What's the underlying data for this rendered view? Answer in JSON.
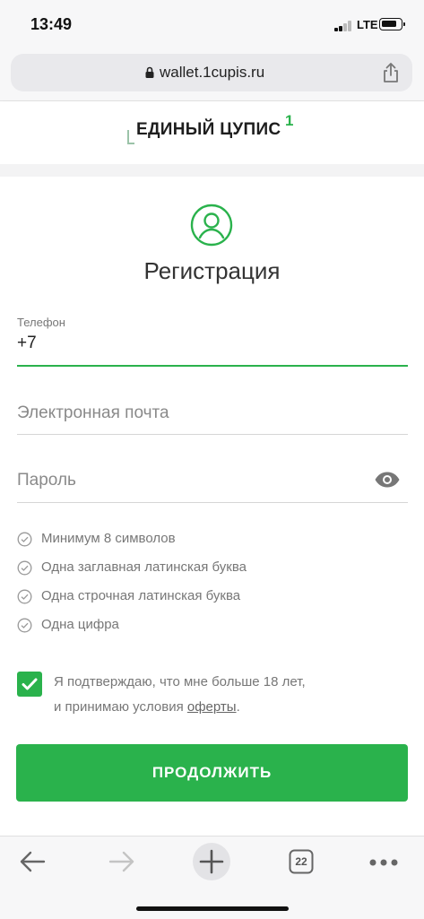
{
  "status_bar": {
    "time": "13:49",
    "network": "LTE"
  },
  "browser": {
    "url": "wallet.1cupis.ru",
    "tabs_count": "22"
  },
  "site": {
    "logo_text": "ЕДИНЫЙ ЦУПИС",
    "logo_mark": "1"
  },
  "form": {
    "title": "Регистрация",
    "phone": {
      "label": "Телефон",
      "value": "+7"
    },
    "email": {
      "placeholder": "Электронная почта"
    },
    "password": {
      "placeholder": "Пароль"
    },
    "rules": [
      "Минимум 8 символов",
      "Одна заглавная латинская буква",
      "Одна строчная латинская буква",
      "Одна цифра"
    ],
    "confirm": {
      "checked": true,
      "line1": "Я подтверждаю, что мне больше 18 лет,",
      "line2_prefix": "и принимаю условия ",
      "line2_link": "оферты",
      "line2_suffix": "."
    },
    "submit_label": "ПРОДОЛЖИТЬ"
  },
  "colors": {
    "accent": "#2ab24c",
    "text_muted": "#8a8a8a"
  }
}
